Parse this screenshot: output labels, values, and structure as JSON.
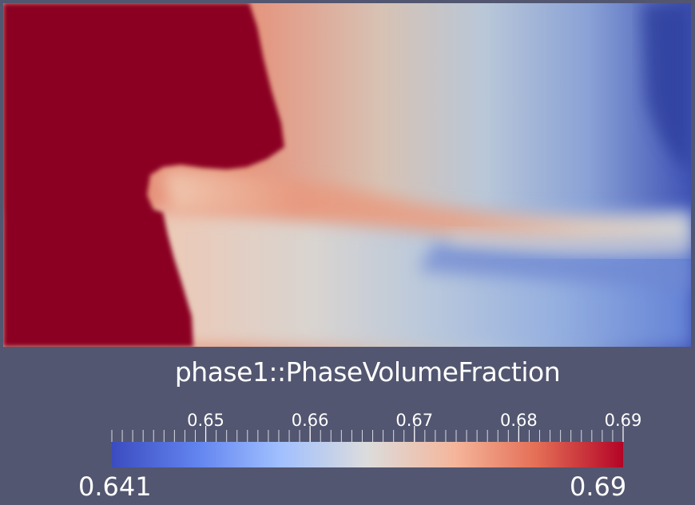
{
  "colormap": {
    "name": "Cool to Warm",
    "stops": [
      "#3b4cc0",
      "#7396f5",
      "#b0cbfc",
      "#dddddd",
      "#f5b89c",
      "#e9785d",
      "#b40426"
    ]
  },
  "field": {
    "title": "phase1::PhaseVolumeFraction",
    "min": 0.641,
    "max": 0.69,
    "min_label": "0.641",
    "max_label": "0.69"
  },
  "colorbar": {
    "tick_labels": [
      {
        "value": 0.65,
        "text": "0.65"
      },
      {
        "value": 0.66,
        "text": "0.66"
      },
      {
        "value": 0.67,
        "text": "0.67"
      },
      {
        "value": 0.68,
        "text": "0.68"
      },
      {
        "value": 0.69,
        "text": "0.69"
      }
    ],
    "minor_tick_step": 0.001
  },
  "render": {
    "background": "#525670",
    "saturated_color": "#8b0320"
  }
}
